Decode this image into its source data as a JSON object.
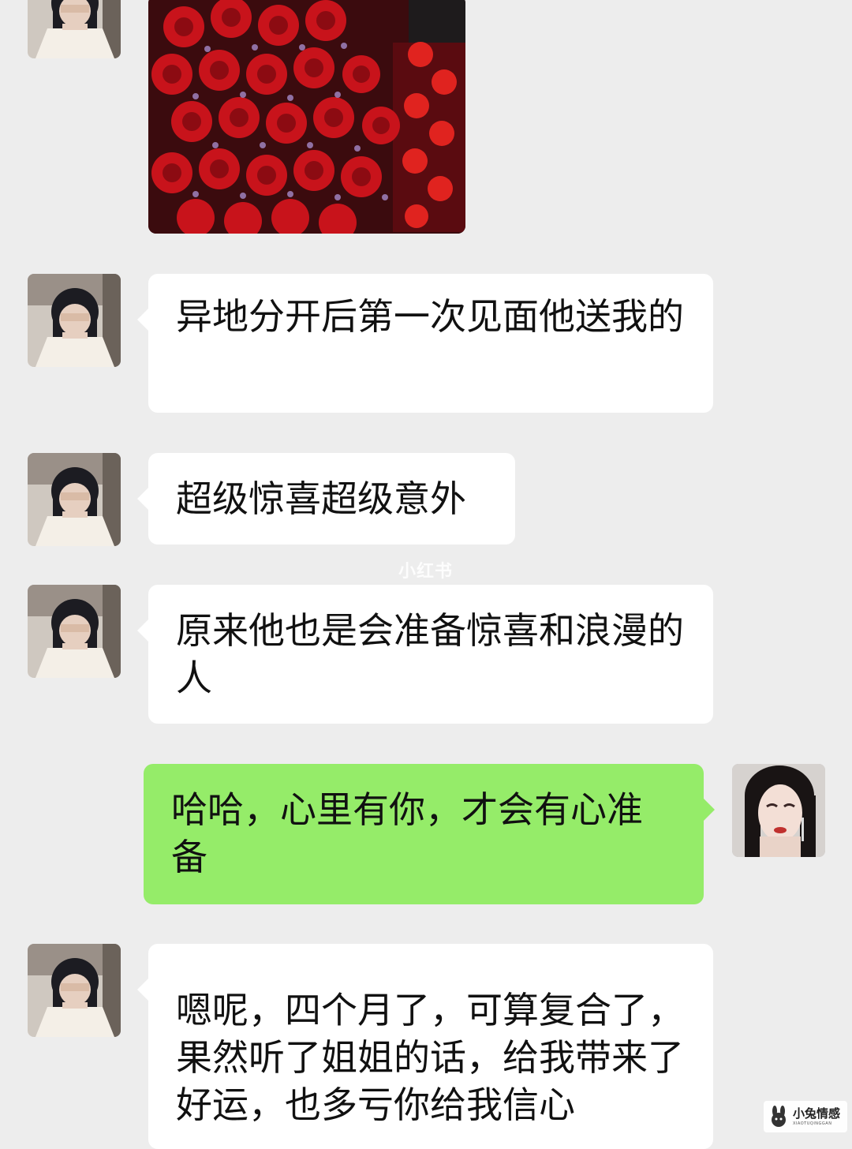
{
  "chat": {
    "messages": [
      {
        "sender": "friend",
        "type": "image",
        "image": "red-roses-and-strawberries-box"
      },
      {
        "sender": "friend",
        "type": "text",
        "text": "异地分开后第一次见面他送我的"
      },
      {
        "sender": "friend",
        "type": "text",
        "text": "超级惊喜超级意外"
      },
      {
        "sender": "friend",
        "type": "text",
        "text": "原来他也是会准备惊喜和浪漫的人"
      },
      {
        "sender": "me",
        "type": "text",
        "text": "哈哈，心里有你，才会有心准备"
      },
      {
        "sender": "friend",
        "type": "text",
        "text": "嗯呢，四个月了，可算复合了，果然听了姐姐的话，给我带来了好运，也多亏你给我信心"
      }
    ]
  },
  "watermarks": {
    "center": "小红书",
    "corner_main": "小兔情感",
    "corner_sub": "XIAOTUQINGGAN"
  },
  "colors": {
    "background": "#ededed",
    "incoming_bubble": "#ffffff",
    "outgoing_bubble": "#95ec69",
    "text": "#111111"
  }
}
